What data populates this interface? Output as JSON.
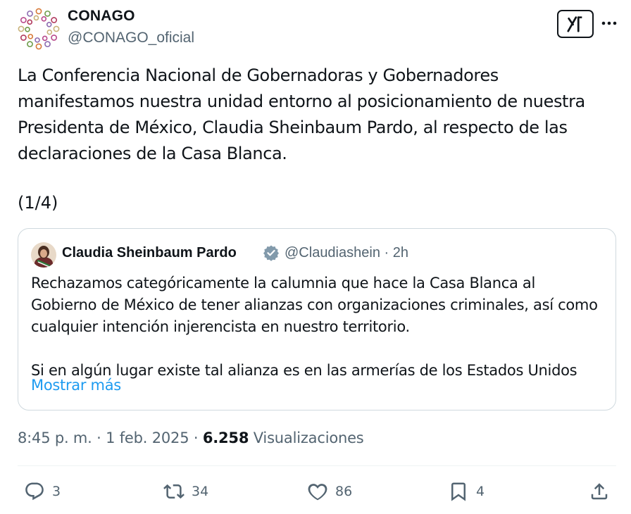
{
  "author": {
    "name": "CONAGO",
    "handle": "@CONAGO_oficial"
  },
  "tweet": {
    "text": "La Conferencia Nacional de Gobernadoras y Gobernadores\nmanifestamos nuestra unidad entorno al posicionamiento de nuestra\nPresidenta de México, Claudia Sheinbaum Pardo, al respecto de las\ndeclaraciones de la Casa Blanca.",
    "thread_marker": "(1/4)"
  },
  "quote": {
    "name": "Claudia Sheinbaum Pardo",
    "handle_time": "@Claudiashein · 2h",
    "text": "Rechazamos categóricamente la calumnia que hace la Casa Blanca al\nGobierno de México de tener alianzas con organizaciones criminales, así como\ncualquier intención injerencista en nuestro territorio.\n\nSi en algún lugar existe tal alianza es en las armerías de los Estados Unidos",
    "show_more": "Mostrar más"
  },
  "meta": {
    "time": "8:45 p. m.",
    "sep1": " · ",
    "date": "1 feb. 2025",
    "sep2": " · ",
    "views_count": "6.258",
    "views_label": " Visualizaciones"
  },
  "actions": {
    "replies": "3",
    "reposts": "34",
    "likes": "86",
    "bookmarks": "4"
  },
  "colors": {
    "text": "#0f1419",
    "secondary": "#536471",
    "link": "#1d9bf0",
    "border": "#cfd9de",
    "verified": "#829aab"
  },
  "icons": [
    "grok-icon",
    "more-icon",
    "verified-badge-icon",
    "reply-icon",
    "repost-icon",
    "like-icon",
    "bookmark-icon",
    "share-icon"
  ]
}
